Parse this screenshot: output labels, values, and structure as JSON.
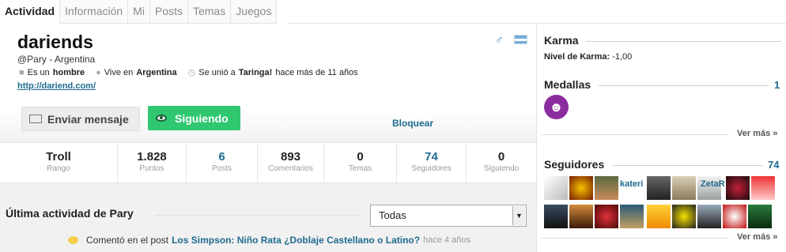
{
  "tabs": [
    "Actividad",
    "Información",
    "Mi",
    "Posts",
    "Temas",
    "Juegos"
  ],
  "profile": {
    "username": "dariends",
    "handle": "@Pary - Argentina",
    "gender_prefix": "Es un",
    "gender": "hombre",
    "lives_prefix": "Vive en",
    "lives": "Argentina",
    "joined_prefix": "Se unió a",
    "joined_site": "Taringa!",
    "joined_suffix": "hace más de 11 años",
    "website": "http://dariend.com/"
  },
  "actions": {
    "message": "Enviar mensaje",
    "follow": "Siguiendo",
    "block": "Bloquear"
  },
  "stats": [
    {
      "value": "Troll",
      "label": "Rango"
    },
    {
      "value": "1.828",
      "label": "Puntos"
    },
    {
      "value": "6",
      "label": "Posts"
    },
    {
      "value": "893",
      "label": "Comentarios"
    },
    {
      "value": "0",
      "label": "Temas"
    },
    {
      "value": "74",
      "label": "Seguidores"
    },
    {
      "value": "0",
      "label": "Siguiendo"
    }
  ],
  "activity": {
    "title": "Última actividad de Pary",
    "filter": "Todas",
    "item_text": "Comentó en el post",
    "item_link": "Los Simpson: Niño Rata ¿Doblaje Castellano o Latino?",
    "item_time": "hace 4 años"
  },
  "sidebar": {
    "karma_title": "Karma",
    "karma_label": "Nivel de Karma:",
    "karma_value": "-1,00",
    "medals_title": "Medallas",
    "medals_count": "1",
    "see_more": "Ver más »",
    "followers_title": "Seguidores",
    "followers_count": "74",
    "follower_names": [
      "kateri",
      "ZetaR"
    ]
  },
  "colors": {
    "accent": "#1f6b8e",
    "follow_green": "#2fc770",
    "medal_purple": "#8b2d9e"
  }
}
